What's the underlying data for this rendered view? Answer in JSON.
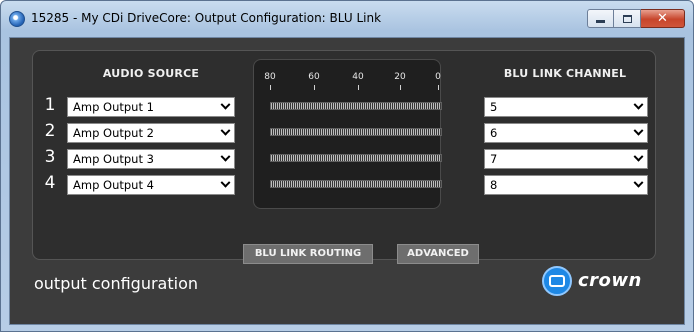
{
  "window": {
    "title": "15285 - My CDi DriveCore: Output Configuration: BLU Link",
    "buttons": {
      "minimize": "–",
      "maximize": "□",
      "close": "✕"
    }
  },
  "audio_source": {
    "heading": "AUDIO SOURCE",
    "rows": [
      {
        "number": "1",
        "value": "Amp Output 1"
      },
      {
        "number": "2",
        "value": "Amp Output 2"
      },
      {
        "number": "3",
        "value": "Amp Output 3"
      },
      {
        "number": "4",
        "value": "Amp Output 4"
      }
    ]
  },
  "meter": {
    "scale_labels": [
      "80",
      "60",
      "40",
      "20",
      "0"
    ]
  },
  "blu_link_channel": {
    "heading": "BLU LINK CHANNEL",
    "values": [
      "5",
      "6",
      "7",
      "8"
    ]
  },
  "tabs": {
    "routing": "BLU LINK ROUTING",
    "advanced": "ADVANCED"
  },
  "footer": {
    "label": "output configuration",
    "brand": "crown"
  },
  "colors": {
    "panel_bg": "#2e2e2e",
    "logo_blue": "#1e88e5"
  }
}
